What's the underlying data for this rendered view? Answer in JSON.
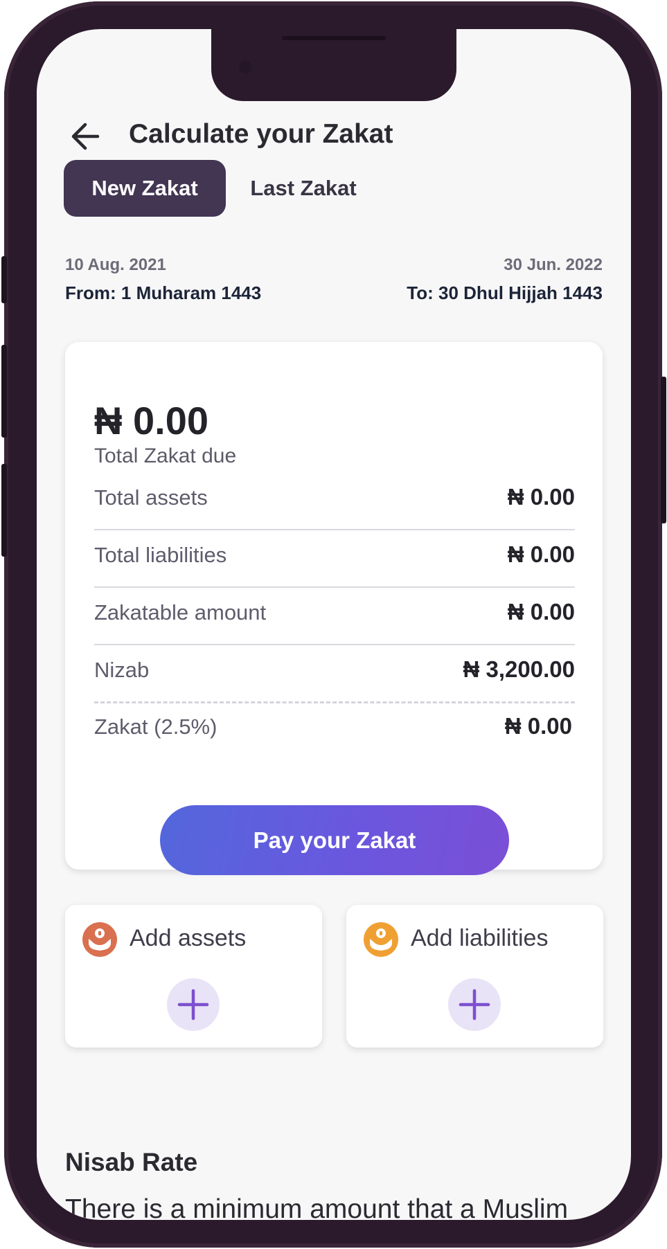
{
  "header": {
    "title": "Calculate your Zakat",
    "back_icon": "arrow-left-icon"
  },
  "tabs": [
    {
      "label": "New Zakat",
      "active": true
    },
    {
      "label": "Last Zakat",
      "active": false
    }
  ],
  "period": {
    "start_gregorian": "10 Aug. 2021",
    "start_hijri": "From: 1 Muharam 1443",
    "end_gregorian": "30 Jun. 2022",
    "end_hijri": "To: 30 Dhul Hijjah 1443"
  },
  "summary": {
    "total_due": "₦ 0.00",
    "total_due_label": "Total Zakat due",
    "rows": [
      {
        "label": "Total assets",
        "value": "₦ 0.00"
      },
      {
        "label": "Total liabilities",
        "value": "₦ 0.00"
      },
      {
        "label": "Zakatable amount",
        "value": "₦ 0.00"
      },
      {
        "label": "Nizab",
        "value": "₦ 3,200.00"
      },
      {
        "label": "Zakat (2.5%)",
        "value": "₦ 0.00"
      }
    ],
    "pay_button_label": "Pay your Zakat"
  },
  "actions": {
    "assets": {
      "label": "Add assets",
      "icon": "hands-coin-icon",
      "color": "#d9704f"
    },
    "liabilities": {
      "label": "Add liabilities",
      "icon": "hands-coin-icon",
      "color": "#f0a033"
    }
  },
  "nisab": {
    "title": "Nisab Rate",
    "text": "There is a minimum amount that a Muslim must have before being obliged"
  },
  "colors": {
    "active_tab": "#423653",
    "pay_gradient_start": "#5367dc",
    "pay_gradient_end": "#7a4fd6",
    "plus_button_bg": "#e8e3f6",
    "plus_icon": "#7d4fd0",
    "phone_frame": "#2b1a2c"
  }
}
